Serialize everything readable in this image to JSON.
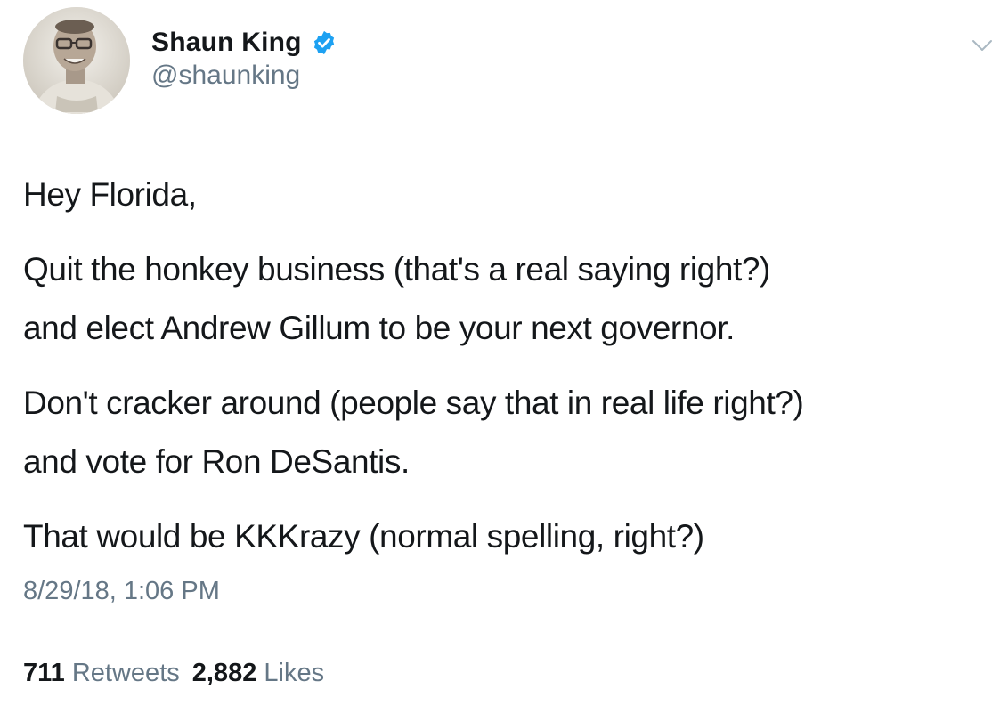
{
  "author": {
    "display_name": "Shaun King",
    "handle": "@shaunking",
    "verified": true,
    "verified_color": "#1da1f2",
    "avatar_icon": "avatar-photo"
  },
  "menu": {
    "caret_icon": "chevron-down-icon"
  },
  "tweet": {
    "greeting": "Hey Florida,",
    "para2_line1": "Quit the honkey business (that's a real saying right?)",
    "para2_line2": "and elect Andrew Gillum to be your next governor.",
    "para3_line1": "Don't cracker around (people say that in real life right?)",
    "para3_line2": "and vote for Ron DeSantis.",
    "para4_line1": "That would be KKKrazy (normal spelling, right?)"
  },
  "timestamp": "8/29/18, 1:06 PM",
  "stats": {
    "retweets_count": "711",
    "retweets_label": "Retweets",
    "likes_count": "2,882",
    "likes_label": "Likes"
  }
}
